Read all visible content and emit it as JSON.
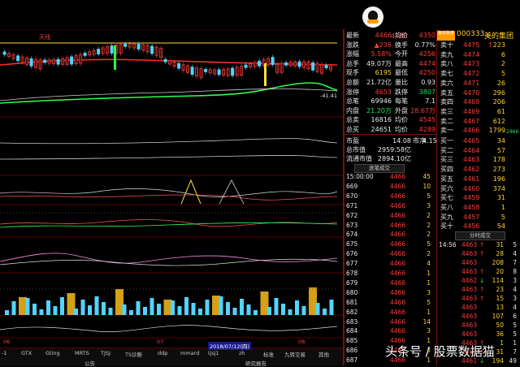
{
  "chart_top_labels": {
    "label_left": "天线",
    "price_right": "4350"
  },
  "price_marker": "-41.41",
  "top_bar_badge": "融资融券",
  "stock": {
    "code": "000333",
    "name": "美的集团"
  },
  "quote_left": [
    {
      "l": "最新",
      "v": "4466",
      "l2": "均价",
      "v2": "4350",
      "c": "red",
      "c2": "red"
    },
    {
      "l": "涨跌",
      "v": "▲236",
      "l2": "换手",
      "v2": "0.77%",
      "c": "red",
      "c2": "white"
    },
    {
      "l": "涨幅",
      "v": "5.58%",
      "l2": "今开",
      "v2": "4256",
      "c": "red",
      "c2": "red"
    },
    {
      "l": "总手",
      "v": "49.07万",
      "l2": "最高",
      "v2": "4474",
      "c": "white",
      "c2": "red"
    },
    {
      "l": "现手",
      "v": "6195",
      "l2": "最低",
      "v2": "4250",
      "c": "yellow",
      "c2": "red"
    },
    {
      "l": "总额",
      "v": "21.72亿",
      "l2": "量比",
      "v2": "0.93",
      "c": "white",
      "c2": "white"
    },
    {
      "l": "涨停",
      "v": "4653",
      "l2": "跌停",
      "v2": "3807",
      "c": "red",
      "c2": "green"
    },
    {
      "l": "总笔",
      "v": "69946",
      "l2": "每笔",
      "v2": "7.1",
      "c": "white",
      "c2": "white"
    },
    {
      "l": "内盘",
      "v": "21.20万",
      "l2": "外盘",
      "v2": "28.67万",
      "c": "green",
      "c2": "red"
    },
    {
      "l": "总卖",
      "v": "16816",
      "l2": "均价",
      "v2": "4545",
      "c": "white",
      "c2": "red"
    },
    {
      "l": "总买",
      "v": "24651",
      "l2": "均价",
      "v2": "4289",
      "c": "white",
      "c2": "red"
    }
  ],
  "quote_extra": [
    {
      "l": "市盈",
      "v": "14.08",
      "l2": "市净",
      "v2": "4.15"
    },
    {
      "l": "总市值",
      "v": "2959.58亿"
    },
    {
      "l": "流通市值",
      "v": "2894.10亿"
    }
  ],
  "order_book": [
    {
      "l": "卖十",
      "p": "4475",
      "q": "223",
      "arrow": "↑"
    },
    {
      "l": "卖九",
      "p": "4474",
      "q": "6"
    },
    {
      "l": "卖八",
      "p": "4473",
      "q": "2"
    },
    {
      "l": "卖七",
      "p": "4472",
      "q": "5"
    },
    {
      "l": "卖六",
      "p": "4471",
      "q": "26"
    },
    {
      "l": "卖五",
      "p": "4470",
      "q": "296"
    },
    {
      "l": "卖四",
      "p": "4469",
      "q": "206"
    },
    {
      "l": "卖三",
      "p": "4469",
      "q": "61"
    },
    {
      "l": "卖二",
      "p": "4467",
      "q": "612"
    },
    {
      "l": "卖一",
      "p": "4466",
      "q": "1799",
      "extra": "-2866"
    },
    {
      "l": "买一",
      "p": "4465",
      "q": "34"
    },
    {
      "l": "买二",
      "p": "4464",
      "q": "57"
    },
    {
      "l": "买三",
      "p": "4463",
      "q": "178"
    },
    {
      "l": "买四",
      "p": "4462",
      "q": "273"
    },
    {
      "l": "买五",
      "p": "4461",
      "q": "196"
    },
    {
      "l": "买六",
      "p": "4460",
      "q": "374"
    },
    {
      "l": "买七",
      "p": "4459",
      "q": "31"
    },
    {
      "l": "买八",
      "p": "4458",
      "q": "1"
    },
    {
      "l": "买九",
      "p": "4457",
      "q": "5"
    },
    {
      "l": "买十",
      "p": "4456",
      "q": "54"
    }
  ],
  "trade_title": "逐笔成交",
  "trades": [
    {
      "t": "15:00:00",
      "p": "4466",
      "v": "45"
    },
    {
      "t": "669",
      "p": "4466",
      "v": "10"
    },
    {
      "t": "670",
      "p": "4466",
      "v": "5"
    },
    {
      "t": "671",
      "p": "4466",
      "v": "3"
    },
    {
      "t": "672",
      "p": "4466",
      "v": "2"
    },
    {
      "t": "673",
      "p": "4466",
      "v": "2"
    },
    {
      "t": "674",
      "p": "4466",
      "v": "2"
    },
    {
      "t": "675",
      "p": "4466",
      "v": "5"
    },
    {
      "t": "676",
      "p": "4466",
      "v": "2"
    },
    {
      "t": "677",
      "p": "4466",
      "v": "4"
    },
    {
      "t": "678",
      "p": "4466",
      "v": "1"
    },
    {
      "t": "679",
      "p": "4466",
      "v": "1"
    },
    {
      "t": "680",
      "p": "4466",
      "v": "3"
    },
    {
      "t": "681",
      "p": "4466",
      "v": "5"
    },
    {
      "t": "682",
      "p": "4466",
      "v": "1"
    },
    {
      "t": "683",
      "p": "4466",
      "v": "14"
    },
    {
      "t": "684",
      "p": "4466",
      "v": "3"
    },
    {
      "t": "685",
      "p": "4466",
      "v": "1"
    },
    {
      "t": "686",
      "p": "4466",
      "v": "3"
    },
    {
      "t": "687",
      "p": "4466",
      "v": "1"
    }
  ],
  "minute_title": "分时成交",
  "minute_trades": [
    {
      "t": "14:56",
      "p": "4463",
      "a": "↑",
      "v": "31",
      "n": "5"
    },
    {
      "t": "",
      "p": "4463",
      "a": "↑",
      "v": "28",
      "n": "4"
    },
    {
      "t": "",
      "p": "4463",
      "a": "",
      "v": "208",
      "n": "7"
    },
    {
      "t": "",
      "p": "4463",
      "a": "↑",
      "v": "20",
      "n": "8"
    },
    {
      "t": "",
      "p": "4462",
      "a": "↓",
      "v": "114",
      "n": "3"
    },
    {
      "t": "",
      "p": "4463",
      "a": "↑",
      "v": "23",
      "n": "4"
    },
    {
      "t": "",
      "p": "4463",
      "a": "↑",
      "v": "15",
      "n": "3"
    },
    {
      "t": "",
      "p": "4463",
      "a": "",
      "v": "13",
      "n": "4"
    },
    {
      "t": "",
      "p": "4463",
      "a": "",
      "v": "107",
      "n": "6"
    },
    {
      "t": "",
      "p": "4463",
      "a": "",
      "v": "50",
      "n": "5"
    },
    {
      "t": "",
      "p": "4463",
      "a": "",
      "v": "36",
      "n": "5"
    },
    {
      "t": "",
      "p": "4463",
      "a": "↑",
      "v": "1",
      "n": "1"
    },
    {
      "t": "",
      "p": "4463",
      "a": "↑",
      "v": "31",
      "n": "7"
    },
    {
      "t": "",
      "p": "4461",
      "a": "↓",
      "v": "194",
      "n": "49"
    }
  ],
  "footer_tabs": [
    "-1",
    "GTX",
    "Gting",
    "MRTS",
    "TJSJ",
    "TS诊断",
    "ddp",
    "mmard",
    "tjsj1",
    "zh",
    "标准",
    "九转交易",
    "其他"
  ],
  "footer_tabs2": [
    "公告",
    "研究报告"
  ],
  "date_label": "2018/07/12(四)",
  "axis_months": [
    "06",
    "07",
    "08"
  ],
  "watermark": "头条号 / 股票数据猫"
}
